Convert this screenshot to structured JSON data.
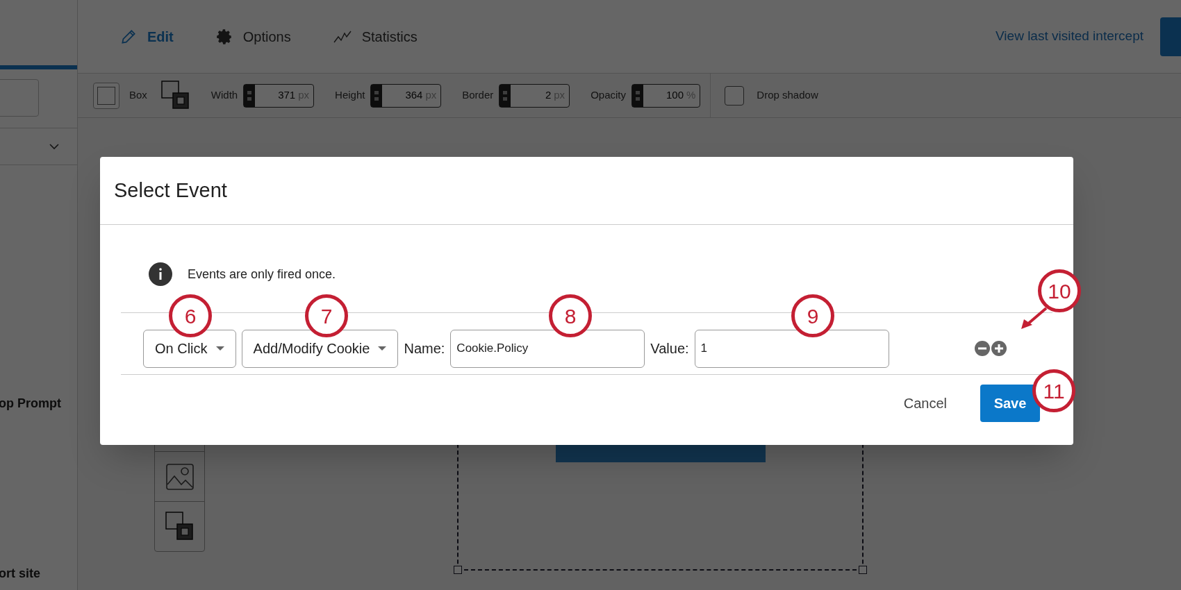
{
  "sidebar": {
    "items": [
      {
        "label": "op Prompt"
      },
      {
        "label": "ort site"
      }
    ]
  },
  "tabs": [
    {
      "label": "Edit",
      "selected": true
    },
    {
      "label": "Options",
      "selected": false
    },
    {
      "label": "Statistics",
      "selected": false
    }
  ],
  "header_link": "View last visited intercept",
  "toolbar": {
    "shape_label": "Box",
    "fields": [
      {
        "label": "Width",
        "value": "371",
        "unit": "px"
      },
      {
        "label": "Height",
        "value": "364",
        "unit": "px"
      },
      {
        "label": "Border",
        "value": "2",
        "unit": "px"
      },
      {
        "label": "Opacity",
        "value": "100",
        "unit": "%"
      }
    ],
    "drop_shadow": {
      "label": "Drop shadow",
      "checked": false
    }
  },
  "dialog": {
    "title": "Select Event",
    "info": "Events are only fired once.",
    "event_row": {
      "trigger": "On Click",
      "action": "Add/Modify Cookie",
      "name_label": "Name:",
      "name_value": "Cookie.Policy",
      "value_label": "Value:",
      "value_value": "1"
    },
    "cancel": "Cancel",
    "save": "Save"
  },
  "callouts": [
    "6",
    "7",
    "8",
    "9",
    "10",
    "11"
  ]
}
